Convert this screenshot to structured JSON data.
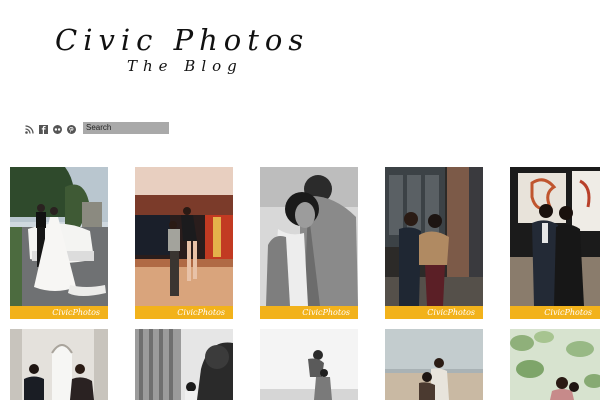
{
  "header": {
    "logo_title": "Civic Photos",
    "logo_subtitle": "The Blog"
  },
  "social": {
    "icons": [
      "rss-icon",
      "facebook-icon",
      "flickr-icon",
      "pinterest-icon"
    ]
  },
  "search": {
    "placeholder": "Search"
  },
  "gallery": {
    "watermark": "CivicPhotos",
    "watermark_color": "#f2b21b",
    "row1": [
      {
        "title": "Wedding couple with white car"
      },
      {
        "title": "Couple at night outside"
      },
      {
        "title": "Black and white couple embrace"
      },
      {
        "title": "Couple in coats by brick column"
      },
      {
        "title": "Couple in front of art wall"
      }
    ],
    "row2": [
      {
        "title": "Wedding couple at window"
      },
      {
        "title": "Couple by trees black and white"
      },
      {
        "title": "Couple lifting black and white"
      },
      {
        "title": "Couple on beach"
      },
      {
        "title": "Couple among leaves"
      }
    ]
  }
}
